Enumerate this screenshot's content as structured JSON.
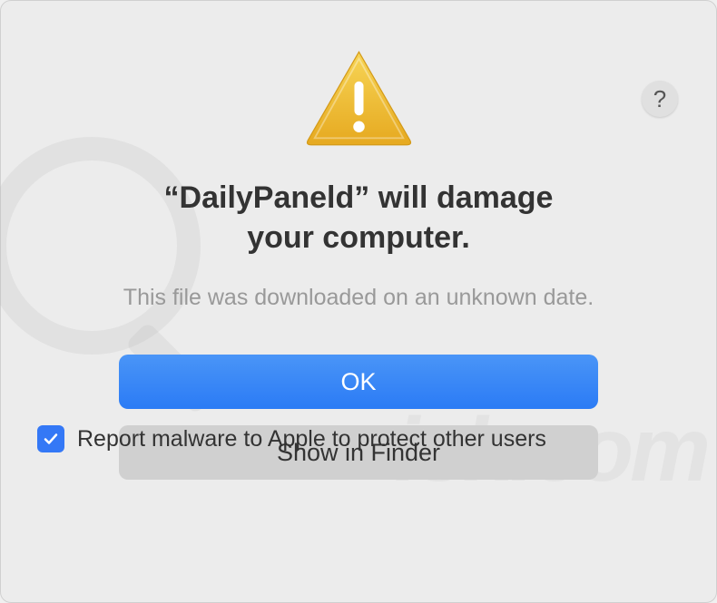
{
  "dialog": {
    "title_line1": "“DailyPaneld” will damage",
    "title_line2": "your computer.",
    "subtitle": "This file was downloaded on an unknown date.",
    "primary_button": "OK",
    "secondary_button": "Show in Finder",
    "checkbox_label": "Report malware to Apple to protect other users",
    "checkbox_checked": true,
    "help_tooltip": "?"
  },
  "watermark": {
    "text": "isk.com"
  }
}
